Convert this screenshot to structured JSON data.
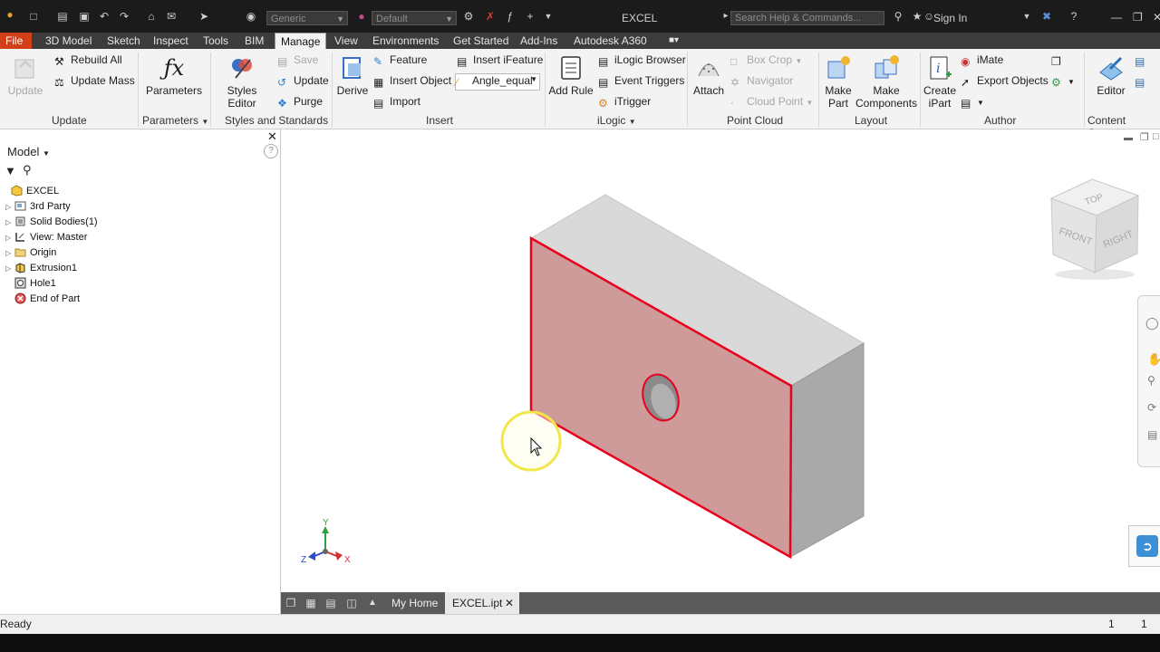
{
  "window": {
    "title": "EXCEL",
    "search_placeholder": "Search Help & Commands...",
    "sign_in": "Sign In"
  },
  "quick_access": {
    "material_combo": "Generic",
    "appearance_combo": "Default"
  },
  "menu_tabs": [
    "File",
    "3D Model",
    "Sketch",
    "Inspect",
    "Tools",
    "BIM",
    "Manage",
    "View",
    "Environments",
    "Get Started",
    "Add-Ins",
    "Autodesk A360"
  ],
  "active_tab": "Manage",
  "ribbon": {
    "update": {
      "big": "Update",
      "rebuild_all": "Rebuild All",
      "update_mass": "Update Mass",
      "label": "Update"
    },
    "parameters": {
      "big": "Parameters",
      "label": "Parameters"
    },
    "styles": {
      "styles_editor": "Styles Editor",
      "save": "Save",
      "update": "Update",
      "purge": "Purge",
      "label": "Styles and Standards"
    },
    "insert": {
      "derive": "Derive",
      "feature": "Feature",
      "insert_object": "Insert Object",
      "import": "Import",
      "insert_ifeature": "Insert iFeature",
      "angle_combo": "Angle_equal",
      "label": "Insert"
    },
    "ilogic": {
      "add_rule": "Add Rule",
      "browser": "iLogic Browser",
      "event_triggers": "Event Triggers",
      "itrigger": "iTrigger",
      "label": "iLogic"
    },
    "point_cloud": {
      "attach": "Attach",
      "box_crop": "Box Crop",
      "navigator": "Navigator",
      "cloud_point": "Cloud Point",
      "label": "Point Cloud"
    },
    "layout": {
      "make_part_1": "Make",
      "make_part_2": "Part",
      "make_comp_1": "Make",
      "make_comp_2": "Components",
      "label": "Layout"
    },
    "author": {
      "create_ipart_1": "Create",
      "create_ipart_2": "iPart",
      "imate": "iMate",
      "export_objects": "Export Objects",
      "label": "Author"
    },
    "content_center": {
      "editor": "Editor",
      "label": "Content Center"
    }
  },
  "browser": {
    "title": "Model",
    "tree": [
      {
        "label": "EXCEL",
        "icon": "part-icon",
        "expandable": false,
        "level": 0
      },
      {
        "label": "3rd Party",
        "icon": "third-party-icon",
        "expandable": true,
        "level": 1
      },
      {
        "label": "Solid Bodies(1)",
        "icon": "solid-bodies-icon",
        "expandable": true,
        "level": 1
      },
      {
        "label": "View: Master",
        "icon": "view-icon",
        "expandable": true,
        "level": 1
      },
      {
        "label": "Origin",
        "icon": "folder-icon",
        "expandable": true,
        "level": 1
      },
      {
        "label": "Extrusion1",
        "icon": "extrusion-icon",
        "expandable": true,
        "level": 1
      },
      {
        "label": "Hole1",
        "icon": "hole-icon",
        "expandable": false,
        "level": 1
      },
      {
        "label": "End of Part",
        "icon": "end-of-part-icon",
        "expandable": false,
        "level": 1
      }
    ]
  },
  "viewcube": {
    "top": "TOP",
    "front": "FRONT",
    "right": "RIGHT"
  },
  "triad": {
    "x": "X",
    "y": "Y",
    "z": "Z"
  },
  "doc_tabs": {
    "home": "My Home",
    "file": "EXCEL.ipt"
  },
  "status": {
    "text": "Ready",
    "count_a": "1",
    "count_b": "1"
  },
  "colors": {
    "file_tab": "#d2401a",
    "selected_face": "#cf9a9a",
    "selected_edge": "#e8001c",
    "body_top": "#d9d9d9",
    "body_side": "#a9a9a9"
  }
}
